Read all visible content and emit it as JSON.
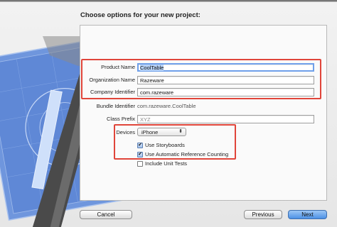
{
  "title": "Choose options for your new project:",
  "form": {
    "product_name": {
      "label": "Product Name",
      "value": "CoolTable"
    },
    "organization_name": {
      "label": "Organization Name",
      "value": "Razeware"
    },
    "company_identifier": {
      "label": "Company Identifier",
      "value": "com.razeware"
    },
    "bundle_identifier": {
      "label": "Bundle Identifier",
      "value": "com.razeware.CoolTable"
    },
    "class_prefix": {
      "label": "Class Prefix",
      "placeholder": "XYZ"
    },
    "devices": {
      "label": "Devices",
      "value": "iPhone",
      "arrows": "⬍"
    },
    "use_storyboards": {
      "label": "Use Storyboards",
      "checked": true
    },
    "use_arc": {
      "label": "Use Automatic Reference Counting",
      "checked": true
    },
    "include_unit_tests": {
      "label": "Include Unit Tests",
      "checked": false
    }
  },
  "checkmark": "✔",
  "buttons": {
    "cancel": "Cancel",
    "previous": "Previous",
    "next": "Next"
  },
  "colors": {
    "highlight": "#e0453a",
    "focus": "#6fa0ea",
    "primary_button": "#4c91e6",
    "blueprint": "#5f88d6"
  }
}
